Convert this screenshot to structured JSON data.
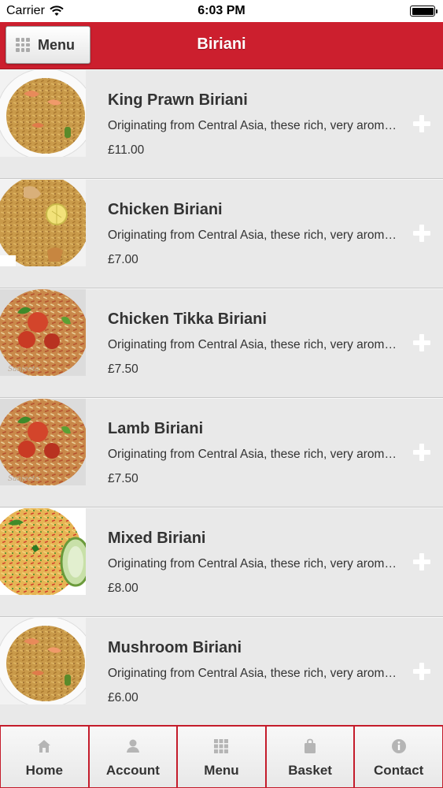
{
  "status_bar": {
    "carrier": "Carrier",
    "time": "6:03 PM"
  },
  "header": {
    "menu_label": "Menu",
    "title": "Biriani",
    "accent_color": "#cc1f2e"
  },
  "items": [
    {
      "name": "King Prawn Biriani",
      "description": "Originating from Central Asia, these rich, very aromatic dishes",
      "price": "£11.00",
      "image": "prawn-biriani"
    },
    {
      "name": "Chicken Biriani",
      "description": "Originating from Central Asia, these rich, very aromatic dishes",
      "price": "£7.00",
      "image": "chicken-biriani"
    },
    {
      "name": "Chicken Tikka Biriani",
      "description": "Originating from Central Asia, these rich, very aromatic dishes",
      "price": "£7.50",
      "image": "tikka-biriani"
    },
    {
      "name": "Lamb Biriani",
      "description": "Originating from Central Asia, these rich, very aromatic dishes",
      "price": "£7.50",
      "image": "tikka-biriani"
    },
    {
      "name": "Mixed Biriani",
      "description": "Originating from Central Asia, these rich, very aromatic dishes",
      "price": "£8.00",
      "image": "mixed-biriani"
    },
    {
      "name": "Mushroom Biriani",
      "description": "Originating from Central Asia, these rich, very aromatic dishes",
      "price": "£6.00",
      "image": "prawn-biriani"
    }
  ],
  "tabs": [
    {
      "label": "Home",
      "icon": "home-icon"
    },
    {
      "label": "Account",
      "icon": "user-icon"
    },
    {
      "label": "Menu",
      "icon": "grid-icon"
    },
    {
      "label": "Basket",
      "icon": "bag-icon"
    },
    {
      "label": "Contact",
      "icon": "info-icon"
    }
  ]
}
